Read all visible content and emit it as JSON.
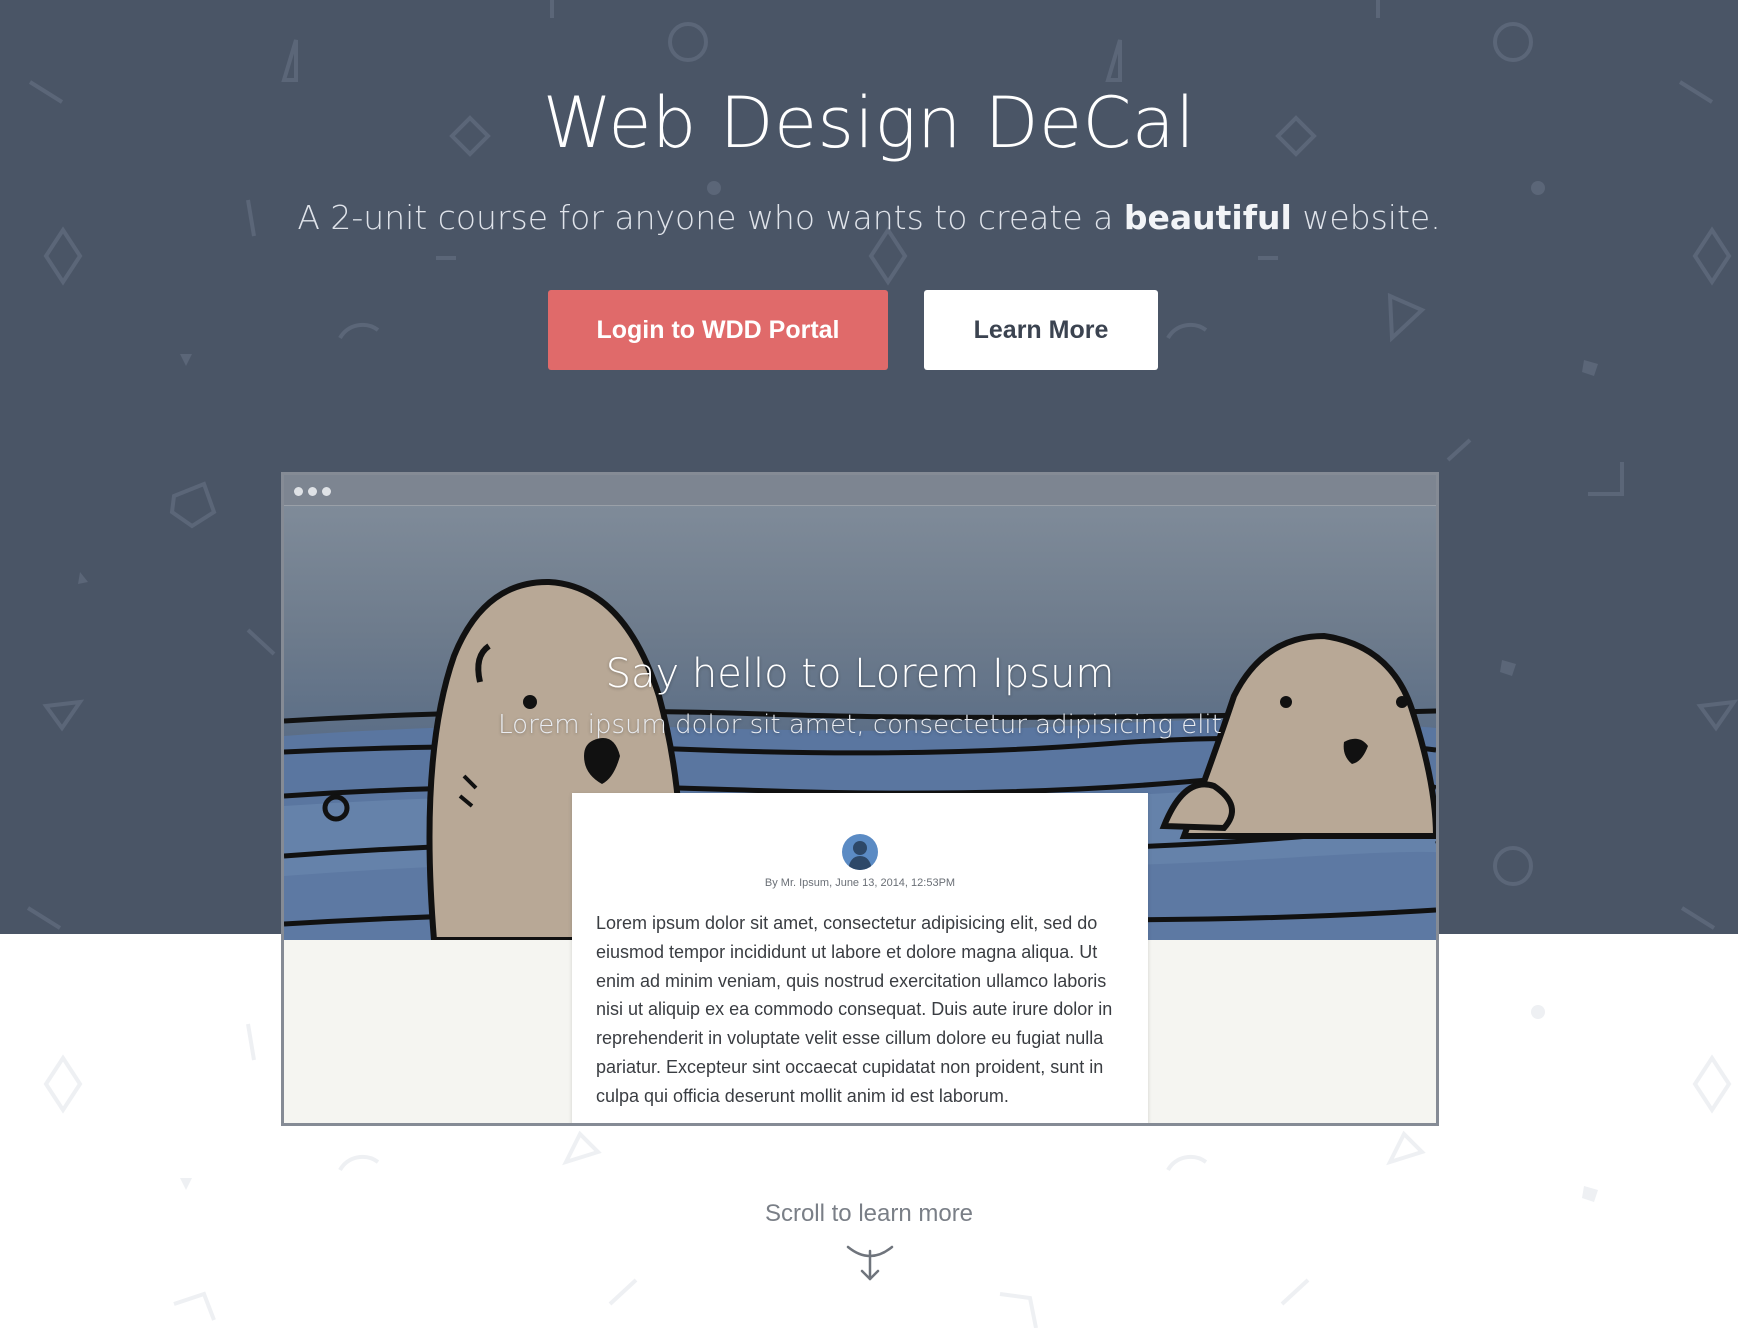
{
  "hero": {
    "title": "Web Design DeCal",
    "subtitle_before": "A 2-unit course for anyone who wants to create a ",
    "subtitle_emphasis": "beautiful",
    "subtitle_after": " website.",
    "login_button": "Login to WDD Portal",
    "learn_button": "Learn More"
  },
  "preview": {
    "title": "Say hello to Lorem Ipsum",
    "subtitle": "Lorem ipsum dolor sit amet, consectetur adipisicing elit",
    "byline": "By Mr. Ipsum, June 13, 2014, 12:53PM",
    "body": "Lorem ipsum dolor sit amet, consectetur adipisicing elit, sed do eiusmod tempor incididunt ut labore et dolore magna aliqua. Ut enim ad minim veniam, quis nostrud exercitation ullamco laboris nisi ut aliquip ex ea commodo consequat. Duis aute irure dolor in reprehenderit in voluptate velit esse cillum dolore eu fugiat nulla pariatur. Excepteur sint occaecat cupidatat non proident, sunt in culpa qui officia deserunt mollit anim id est laborum."
  },
  "footer": {
    "scroll_text": "Scroll to learn more",
    "scroll_icon": "arrow-down-icon"
  },
  "colors": {
    "hero_bg": "#4a5566",
    "login_button_bg": "#e06a6a",
    "learn_button_bg": "#ffffff",
    "text_light": "#ffffff"
  }
}
